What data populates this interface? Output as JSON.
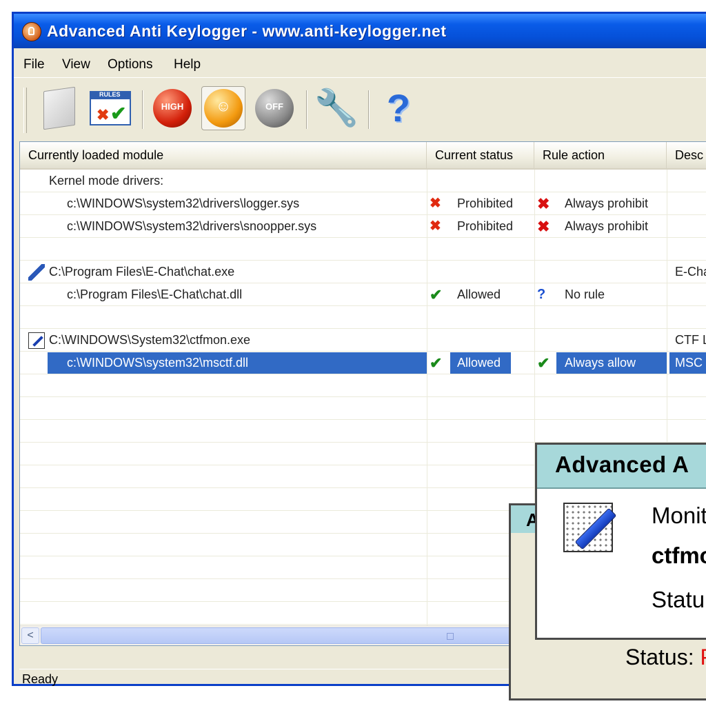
{
  "window": {
    "title": "Advanced Anti Keylogger - www.anti-keylogger.net"
  },
  "menu": [
    "File",
    "View",
    "Options",
    "Help"
  ],
  "toolbar": {
    "buttons": [
      {
        "icon": "document-icon"
      },
      {
        "icon": "rules-icon",
        "header_text": "RULES"
      },
      {
        "icon": "high-protection-icon",
        "text": "HIGH"
      },
      {
        "icon": "medium-protection-icon"
      },
      {
        "icon": "off-protection-icon",
        "text": "OFF"
      },
      {
        "icon": "settings-wrench-icon"
      },
      {
        "icon": "help-icon"
      }
    ]
  },
  "listview": {
    "columns": [
      "Currently loaded module",
      "Current status",
      "Rule action",
      "Desc"
    ],
    "rows": [
      {
        "type": "group",
        "icon": "kernel",
        "module": "Kernel mode drivers:",
        "status": "",
        "rule": "",
        "desc": ""
      },
      {
        "type": "item",
        "module": "c:\\WINDOWS\\system32\\drivers\\logger.sys",
        "status_icon": "x",
        "status": "Prohibited",
        "rule_icon": "xb",
        "rule": "Always prohibit",
        "desc": ""
      },
      {
        "type": "item",
        "module": "c:\\WINDOWS\\system32\\drivers\\snoopper.sys",
        "status_icon": "x",
        "status": "Prohibited",
        "rule_icon": "xb",
        "rule": "Always prohibit",
        "desc": ""
      },
      {
        "type": "blank"
      },
      {
        "type": "group",
        "icon": "chat",
        "module": "C:\\Program Files\\E-Chat\\chat.exe",
        "status": "",
        "rule": "",
        "desc": "E-Cha"
      },
      {
        "type": "item",
        "module": "c:\\Program Files\\E-Chat\\chat.dll",
        "status_icon": "ok",
        "status": "Allowed",
        "rule_icon": "q",
        "rule": "No rule",
        "desc": ""
      },
      {
        "type": "blank"
      },
      {
        "type": "group",
        "icon": "ctf",
        "module": "C:\\WINDOWS\\System32\\ctfmon.exe",
        "status": "",
        "rule": "",
        "desc": "CTF L"
      },
      {
        "type": "item",
        "selected": true,
        "module": "c:\\WINDOWS\\system32\\msctf.dll",
        "status_icon": "ok",
        "status": "Allowed",
        "rule_icon": "ok",
        "rule": "Always allow",
        "desc": "MSC"
      }
    ]
  },
  "statusbar": {
    "text": "Ready"
  },
  "popup_front": {
    "title": "Advanced A",
    "line1": "Monit",
    "line2": "ctfmo",
    "line3": "Statu"
  },
  "popup_back": {
    "title": "A",
    "status_label": "Status:",
    "status_value": "P"
  },
  "colors": {
    "selection": "#316ac5",
    "titlebar": "#0a5ce8",
    "popup_title": "#a7d8da"
  }
}
